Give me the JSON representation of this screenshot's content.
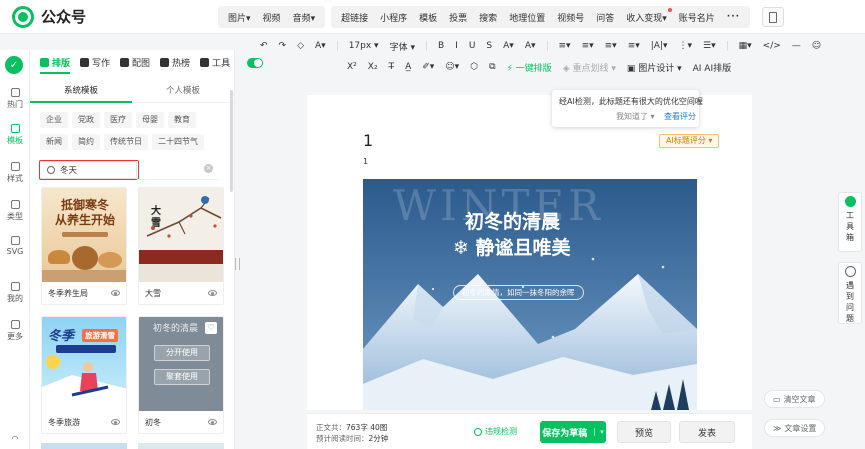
{
  "app": {
    "name": "公众号"
  },
  "topnav": {
    "groups": [
      [
        {
          "label": "图片",
          "caret": true
        },
        {
          "label": "视频"
        },
        {
          "label": "音频",
          "caret": true
        }
      ],
      [
        {
          "label": "超链接"
        },
        {
          "label": "小程序"
        },
        {
          "label": "模板"
        },
        {
          "label": "投票"
        },
        {
          "label": "搜索"
        },
        {
          "label": "地理位置"
        },
        {
          "label": "视频号"
        },
        {
          "label": "问答"
        },
        {
          "label": "收入变现",
          "caret": true,
          "dot": true
        },
        {
          "label": "账号名片"
        },
        {
          "label": "···"
        }
      ]
    ]
  },
  "rail": {
    "items": [
      {
        "id": "hot",
        "label": "热门"
      },
      {
        "id": "template",
        "label": "模板",
        "active": true
      },
      {
        "id": "style",
        "label": "样式"
      },
      {
        "id": "type",
        "label": "类型"
      },
      {
        "id": "svg",
        "label": "SVG"
      },
      {
        "id": "mine",
        "label": "我的"
      },
      {
        "id": "more",
        "label": "更多"
      }
    ]
  },
  "panel": {
    "tabs": [
      {
        "label": "排版",
        "active": true
      },
      {
        "label": "写作"
      },
      {
        "label": "配图"
      },
      {
        "label": "热榜"
      },
      {
        "label": "工具"
      }
    ],
    "subtabs": [
      {
        "label": "系统模板",
        "active": true
      },
      {
        "label": "个人模板"
      }
    ],
    "categories": [
      "企业",
      "党政",
      "医疗",
      "母婴",
      "教育",
      "新闻",
      "简约",
      "传统节日",
      "二十四节气"
    ],
    "search": {
      "value": "冬天",
      "clear": "×"
    },
    "cards": [
      {
        "title": "冬季养生局",
        "thumb_text": [
          "抵御寒冬",
          "从养生开始"
        ]
      },
      {
        "title": "大雪",
        "thumb_text": [
          "大",
          "雪"
        ]
      },
      {
        "title": "冬季旅游",
        "thumb_text": [
          "冬季",
          "旅游滑雪"
        ]
      },
      {
        "title": "初冬",
        "thumb_text": [
          "初冬的清晨"
        ],
        "buttons": [
          "分开使用",
          "聚套使用"
        ]
      }
    ]
  },
  "toolbar": {
    "row1": [
      "↶",
      "↷",
      "◇",
      "A▾",
      "17px ▾",
      "字体 ▾",
      "B",
      "I",
      "U",
      "S",
      "A▾",
      "A▾",
      "≡▾",
      "≡▾",
      "≡▾",
      "≡▾",
      "|A|▾",
      "⋮▾",
      "☰▾",
      "▦▾",
      "</>",
      "—",
      "☺"
    ],
    "row2": [
      "X²",
      "X₂",
      "T̶",
      "A̲",
      "✐▾",
      "☺▾",
      "⬡",
      "⧉",
      "⚡ 一键排版",
      "◈ 重点划线 ▾",
      "▣ 图片设计 ▾",
      "AI AI排版"
    ]
  },
  "article": {
    "title": "1",
    "body": "1",
    "ai_tag": "AI标题评分 ▾",
    "cover": {
      "watermark": "WINTER",
      "headline_1": "初冬的清晨",
      "headline_2": "❄ 静谧且唯美",
      "tagline": "初冬的柔情，如同一抹冬阳的余晖"
    }
  },
  "tooltip": {
    "text": "经AI检测，此标题还有很大的优化空间喔",
    "ok": "我知道了 ▾",
    "view": "查看评分"
  },
  "bottombar": {
    "stat_line1_label": "正文共：",
    "stat_line1_value": "763字 40图",
    "stat_line2_label": "预计阅读时间：",
    "stat_line2_value": "2分钟",
    "check": "违规检测",
    "save": "保存为草稿",
    "preview": "预览",
    "publish": "发表"
  },
  "side": {
    "clear": "清空文章",
    "settings": "文章设置",
    "toolbox": [
      "工",
      "具",
      "箱"
    ],
    "feedback": [
      "遇",
      "到",
      "问",
      "题"
    ]
  },
  "colors": {
    "accent": "#07c160",
    "highlight": "#e53935",
    "link": "#1e7fd8"
  }
}
